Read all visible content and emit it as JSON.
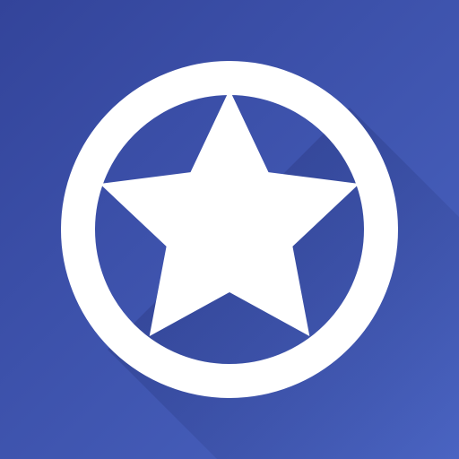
{
  "icon": {
    "name": "star-in-circle-icon",
    "colors": {
      "background_top_left": "#33449a",
      "background_bottom_right": "#4a64c2",
      "shadow": "#25347a",
      "emblem": "#ffffff"
    }
  }
}
